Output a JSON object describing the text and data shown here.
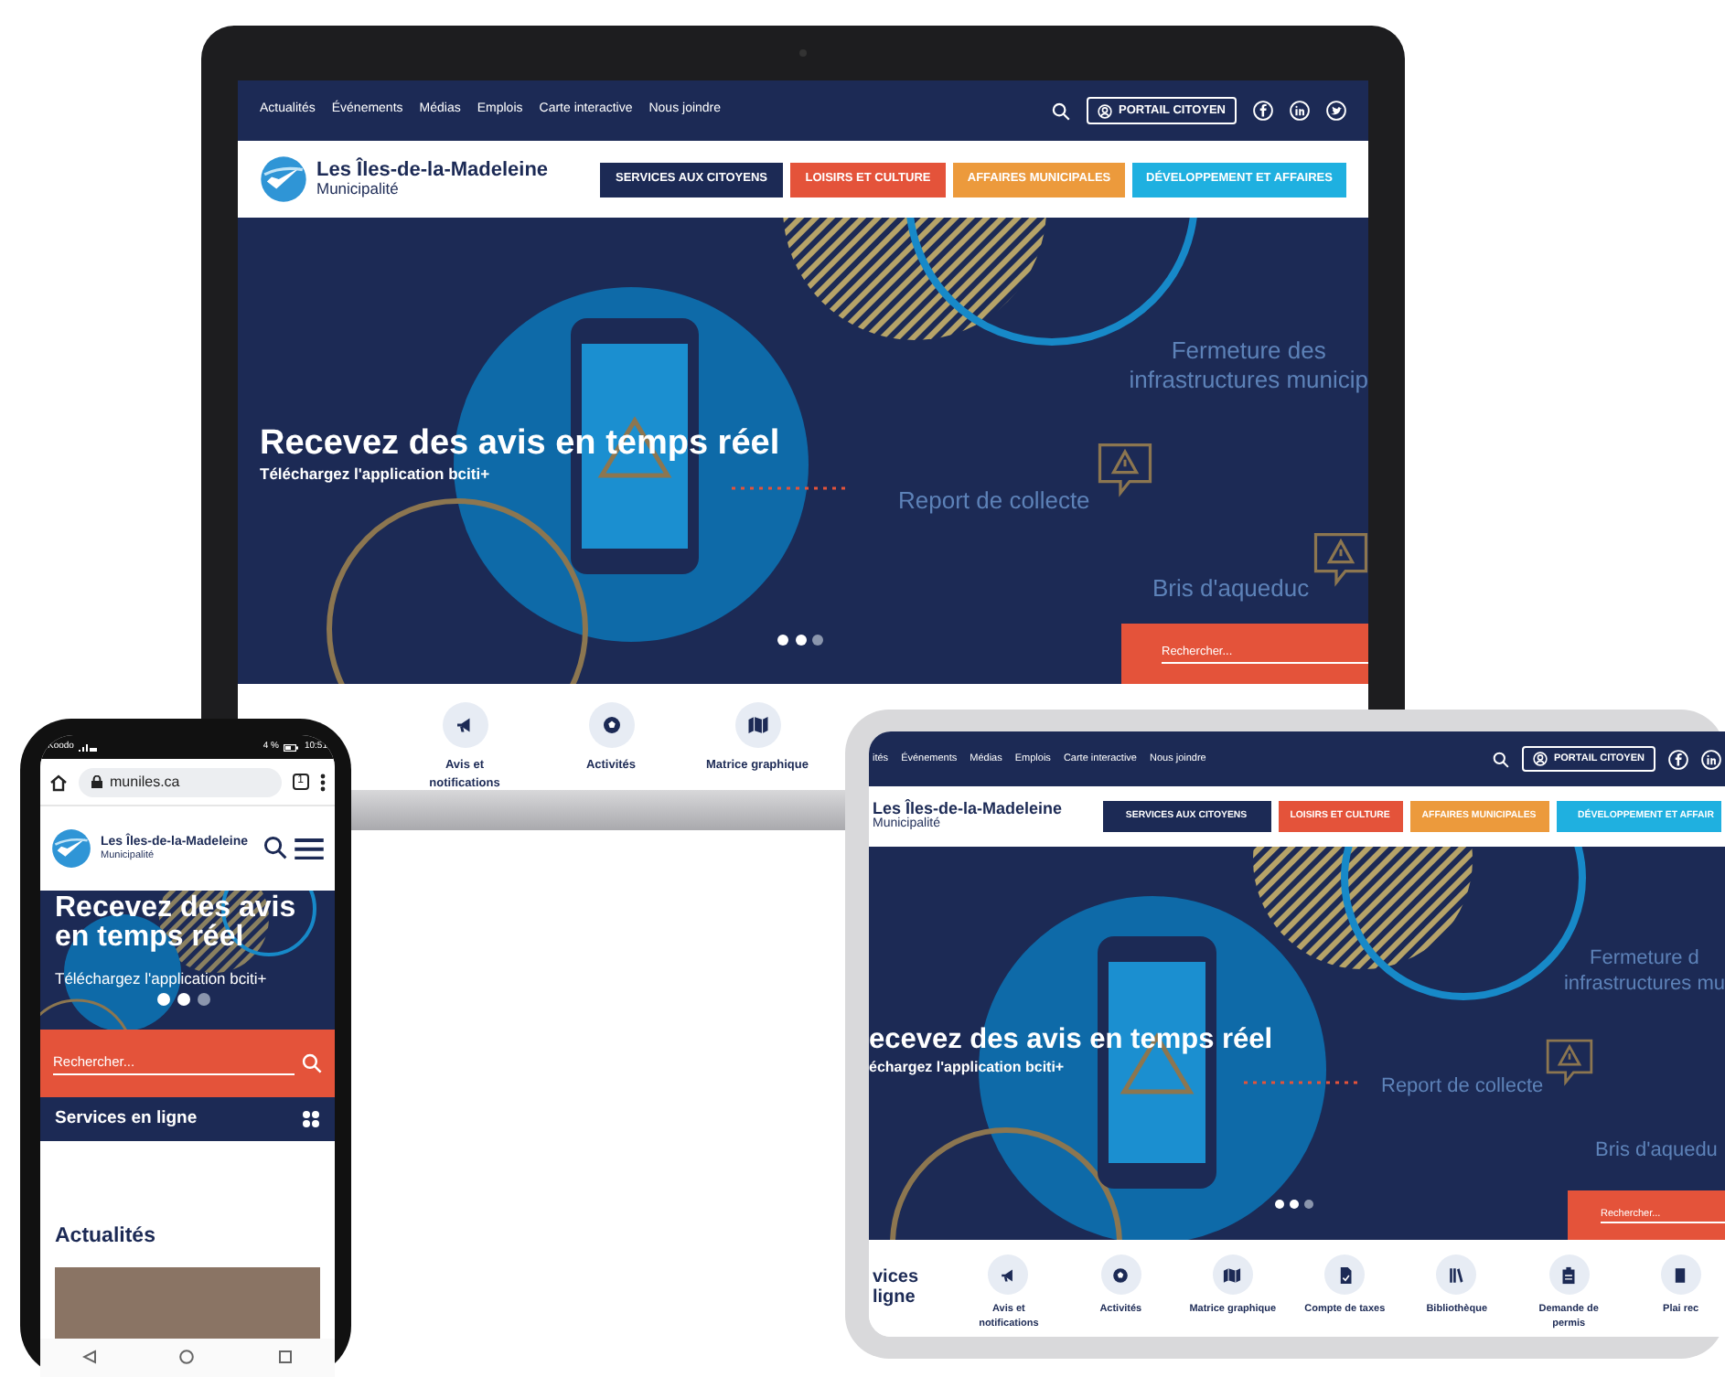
{
  "laptop": {
    "top_links": [
      "Actualités",
      "Événements",
      "Médias",
      "Emplois",
      "Carte interactive",
      "Nous joindre"
    ],
    "portal_button": "PORTAIL CITOYEN",
    "logo": {
      "name": "Les Îles-de-la-Madeleine",
      "subtitle": "Municipalité"
    },
    "main_nav": [
      {
        "label": "SERVICES AUX CITOYENS",
        "color": "#1c2a55"
      },
      {
        "label": "LOISIRS ET CULTURE",
        "color": "#e4533a"
      },
      {
        "label": "AFFAIRES MUNICIPALES",
        "color": "#ec9a3c"
      },
      {
        "label": "DÉVELOPPEMENT ET AFFAIRES",
        "color": "#1fb0e0"
      }
    ],
    "hero": {
      "title": "Recevez des avis en temps réel",
      "subtitle": "Téléchargez l'application bciti+",
      "notices": [
        {
          "lines": [
            "Fermeture des",
            "infrastructures municip"
          ]
        },
        {
          "lines": [
            "Report de collecte"
          ]
        },
        {
          "lines": [
            "Bris d'aqueduc"
          ]
        }
      ],
      "dots": [
        {
          "selected": true
        },
        {
          "selected": true
        },
        {
          "selected": false
        }
      ],
      "search_placeholder": "Rechercher..."
    },
    "services": {
      "items": [
        {
          "label": "Avis et notifications"
        },
        {
          "label": "Activités"
        },
        {
          "label": "Matrice graphique"
        }
      ]
    }
  },
  "tablet": {
    "top_links": [
      "ités",
      "Événements",
      "Médias",
      "Emplois",
      "Carte interactive",
      "Nous joindre"
    ],
    "portal_button": "PORTAIL CITOYEN",
    "logo": {
      "name": "Les Îles-de-la-Madeleine",
      "subtitle": "Municipalité"
    },
    "main_nav": [
      {
        "label": "SERVICES AUX CITOYENS",
        "color": "#1c2a55"
      },
      {
        "label": "LOISIRS ET CULTURE",
        "color": "#e4533a"
      },
      {
        "label": "AFFAIRES MUNICIPALES",
        "color": "#ec9a3c"
      },
      {
        "label": "DÉVELOPPEMENT ET AFFAIR",
        "color": "#1fb0e0"
      }
    ],
    "hero": {
      "title": "ecevez des avis en temps réel",
      "subtitle": "échargez l'application bciti+",
      "notices": [
        {
          "lines": [
            "Fermeture d",
            "infrastructures mu"
          ]
        },
        {
          "lines": [
            "Report de collecte"
          ]
        },
        {
          "lines": [
            "Bris d'aquedu"
          ]
        }
      ],
      "dots": [
        {
          "selected": true
        },
        {
          "selected": true
        },
        {
          "selected": false
        }
      ],
      "search_placeholder": "Rechercher..."
    },
    "services": {
      "heading": "vices ligne",
      "items": [
        {
          "label": "Avis et notifications"
        },
        {
          "label": "Activités"
        },
        {
          "label": "Matrice graphique"
        },
        {
          "label": "Compte de taxes"
        },
        {
          "label": "Bibliothèque"
        },
        {
          "label": "Demande de permis"
        },
        {
          "label": "Plai rec"
        }
      ]
    }
  },
  "phone": {
    "status_bar": {
      "carrier": "Koodo",
      "battery": "4 %",
      "time": "10:51"
    },
    "browser": {
      "url": "muniles.ca",
      "tab_count": "1"
    },
    "logo": {
      "name": "Les Îles-de-la-Madeleine",
      "subtitle": "Municipalité"
    },
    "hero": {
      "title": "Recevez des avis en temps réel",
      "subtitle": "Téléchargez l'application bciti+",
      "dots": [
        {
          "selected": true
        },
        {
          "selected": true
        },
        {
          "selected": false
        }
      ]
    },
    "search_placeholder": "Rechercher...",
    "services_heading": "Services en ligne",
    "news_heading": "Actualités"
  }
}
